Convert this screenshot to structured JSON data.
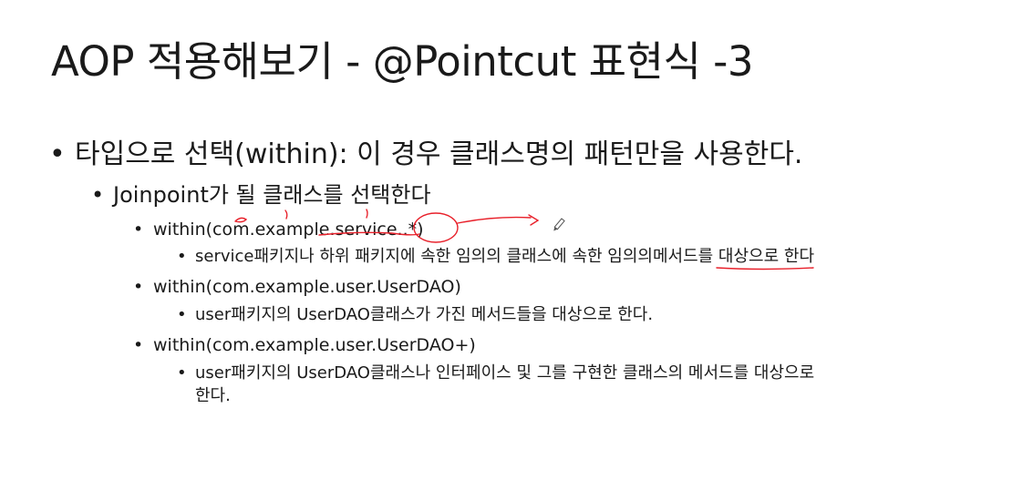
{
  "slide": {
    "title": "AOP 적용해보기 - @Pointcut 표현식 -3",
    "bullet_char": "•",
    "items": [
      {
        "level": 1,
        "text": "타입으로 선택(within): 이 경우 클래스명의 패턴만을 사용한다."
      },
      {
        "level": 2,
        "text": "Joinpoint가 될 클래스를 선택한다"
      },
      {
        "level": 3,
        "text": "within(com.example.service..*)"
      },
      {
        "level": 4,
        "text": "service패키지나 하위 패키지에 속한 임의의 클래스에 속한 임의의메서드를 대상으로 한다"
      },
      {
        "level": 3,
        "text": "within(com.example.user.UserDAO)"
      },
      {
        "level": 4,
        "text": "user패키지의 UserDAO클래스가 가진 메서드들을 대상으로 한다."
      },
      {
        "level": 3,
        "text": "within(com.example.user.UserDAO+)"
      },
      {
        "level": 4,
        "text": "user패키지의 UserDAO클래스나 인터페이스 및 그를 구현한 클래스의 메서드를 대상으로",
        "continuation": "한다."
      }
    ]
  },
  "colors": {
    "text": "#1a1a1a",
    "annotation_ink": "#e8202a",
    "pen_icon": "#555555"
  },
  "icons": [
    "pen-cursor-icon"
  ]
}
